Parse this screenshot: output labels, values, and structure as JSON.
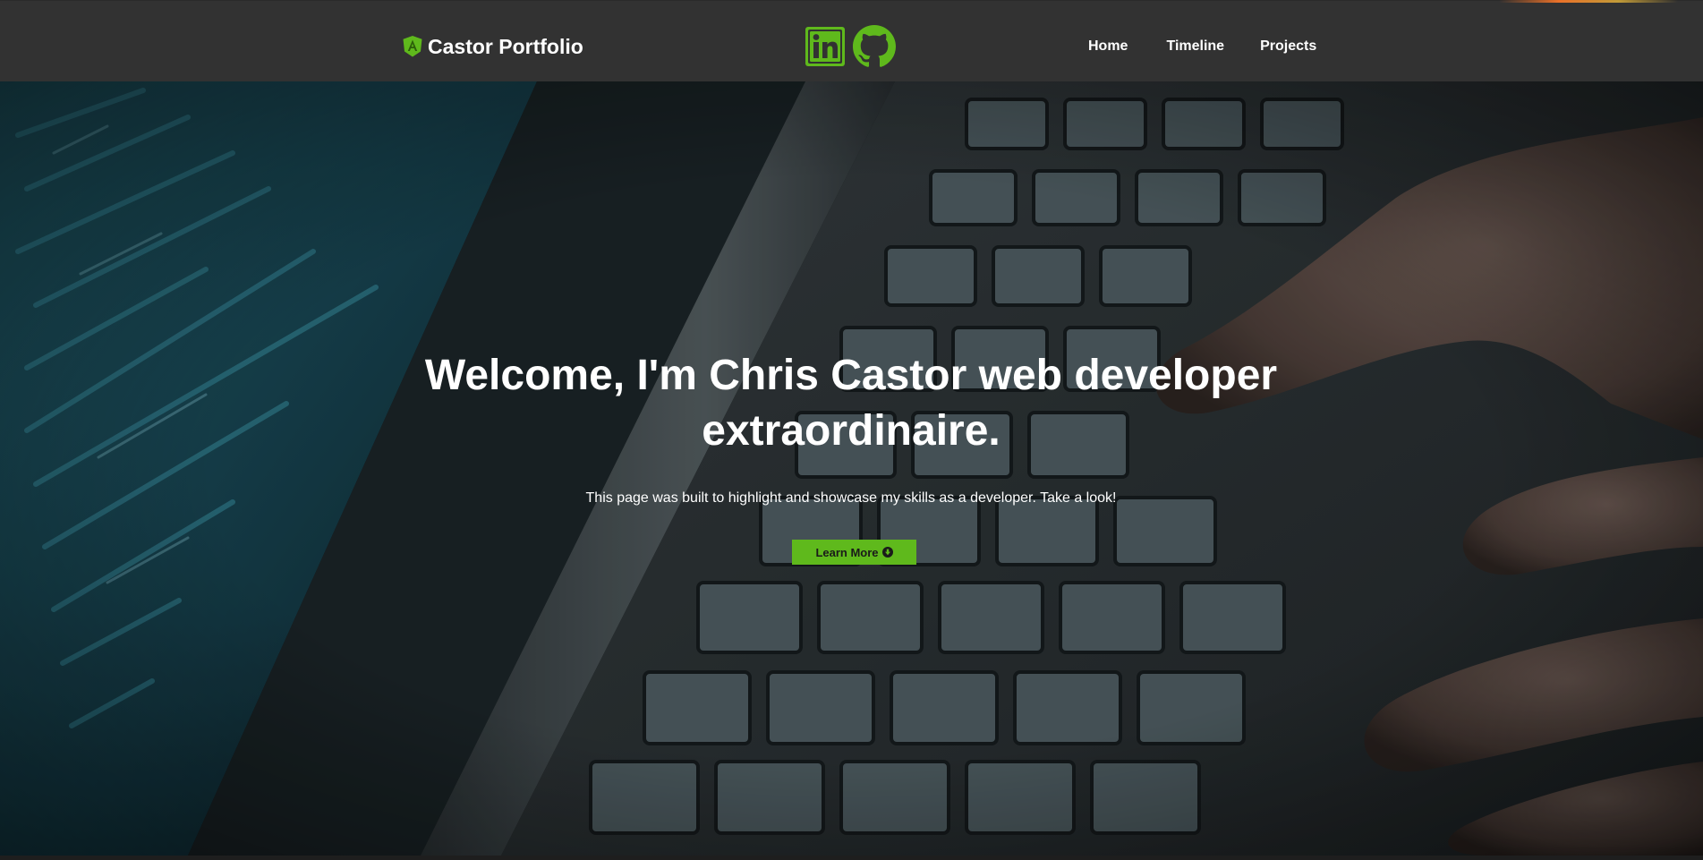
{
  "header": {
    "brand": "Castor Portfolio",
    "brand_icon": "angular-shield-icon",
    "social": [
      {
        "name": "LinkedIn",
        "icon": "linkedin-icon"
      },
      {
        "name": "GitHub",
        "icon": "github-icon"
      }
    ],
    "nav": {
      "home": "Home",
      "timeline": "Timeline",
      "projects": "Projects"
    }
  },
  "hero": {
    "title": "Welcome, I'm Chris Castor web developer extraordinaire.",
    "subtitle": "This page was built to highlight and showcase my skills as a developer. Take a look!",
    "cta_label": "Learn More",
    "cta_icon": "arrow-circle-down-icon",
    "background": "photo of hands typing on a laptop keyboard next to a screen showing code"
  },
  "colors": {
    "accent": "#5fb91c",
    "navbar": "#323232",
    "text": "#ffffff",
    "cta_text": "#1a1a1a"
  }
}
